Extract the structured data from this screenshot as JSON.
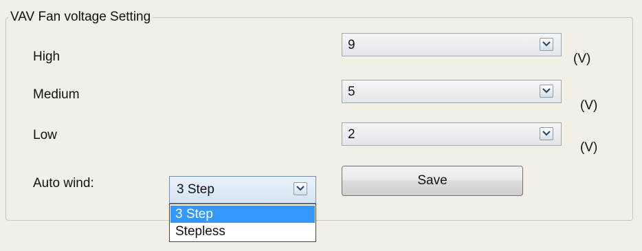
{
  "group": {
    "title": "VAV Fan voltage Setting"
  },
  "rows": [
    {
      "label": "High",
      "value": "9",
      "unit": "(V)"
    },
    {
      "label": "Medium",
      "value": "5",
      "unit": "(V)"
    },
    {
      "label": "Low",
      "value": "2",
      "unit": "(V)"
    }
  ],
  "auto_wind": {
    "label": "Auto wind:",
    "selected": "3 Step",
    "options": [
      "3 Step",
      "Stepless"
    ]
  },
  "save_label": "Save",
  "icons": {
    "dropdown": "chevron-down-icon"
  },
  "colors": {
    "background": "#f1efe6",
    "selection": "#3399ff"
  }
}
